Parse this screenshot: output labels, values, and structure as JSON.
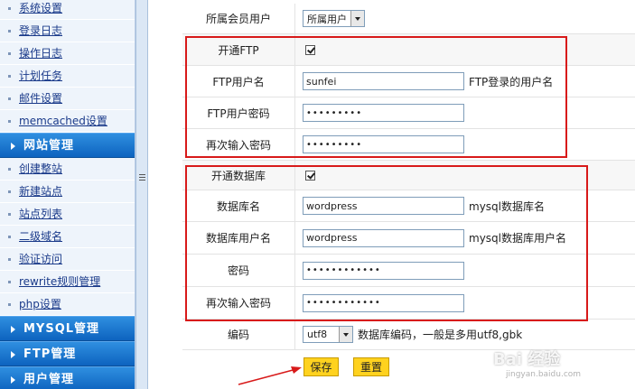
{
  "sidebar": {
    "top_items": [
      "系统设置",
      "登录日志",
      "操作日志",
      "计划任务",
      "邮件设置",
      "memcached设置"
    ],
    "section_site": "网站管理",
    "site_items": [
      "创建整站",
      "新建站点",
      "站点列表",
      "二级域名",
      "验证访问",
      "rewrite规则管理",
      "php设置"
    ],
    "section_mysql": "MYSQL管理",
    "section_ftp": "FTP管理",
    "section_user": "用户管理"
  },
  "form": {
    "member": {
      "label": "所属会员用户",
      "value": "所属用户"
    },
    "ftp_enable": {
      "label": "开通FTP",
      "checked": true
    },
    "ftp_user": {
      "label": "FTP用户名",
      "value": "sunfei",
      "hint": "FTP登录的用户名"
    },
    "ftp_pass": {
      "label": "FTP用户密码",
      "value": "•••••••••"
    },
    "ftp_pass2": {
      "label": "再次输入密码",
      "value": "•••••••••"
    },
    "db_enable": {
      "label": "开通数据库",
      "checked": true
    },
    "db_name": {
      "label": "数据库名",
      "value": "wordpress",
      "hint": "mysql数据库名"
    },
    "db_user": {
      "label": "数据库用户名",
      "value": "wordpress",
      "hint": "mysql数据库用户名"
    },
    "db_pass": {
      "label": "密码",
      "value": "••••••••••••"
    },
    "db_pass2": {
      "label": "再次输入密码",
      "value": "••••••••••••"
    },
    "encoding": {
      "label": "编码",
      "value": "utf8",
      "hint": "数据库编码，一般是多用utf8,gbk"
    },
    "save_label": "保存",
    "reset_label": "重置"
  },
  "watermark": {
    "brand": "Bai 经验",
    "sub": "jingyan.baidu.com"
  },
  "colors": {
    "sidebar_head": "#1a78d4",
    "highlight_box": "#d81a1a",
    "button": "#ffd21f"
  }
}
